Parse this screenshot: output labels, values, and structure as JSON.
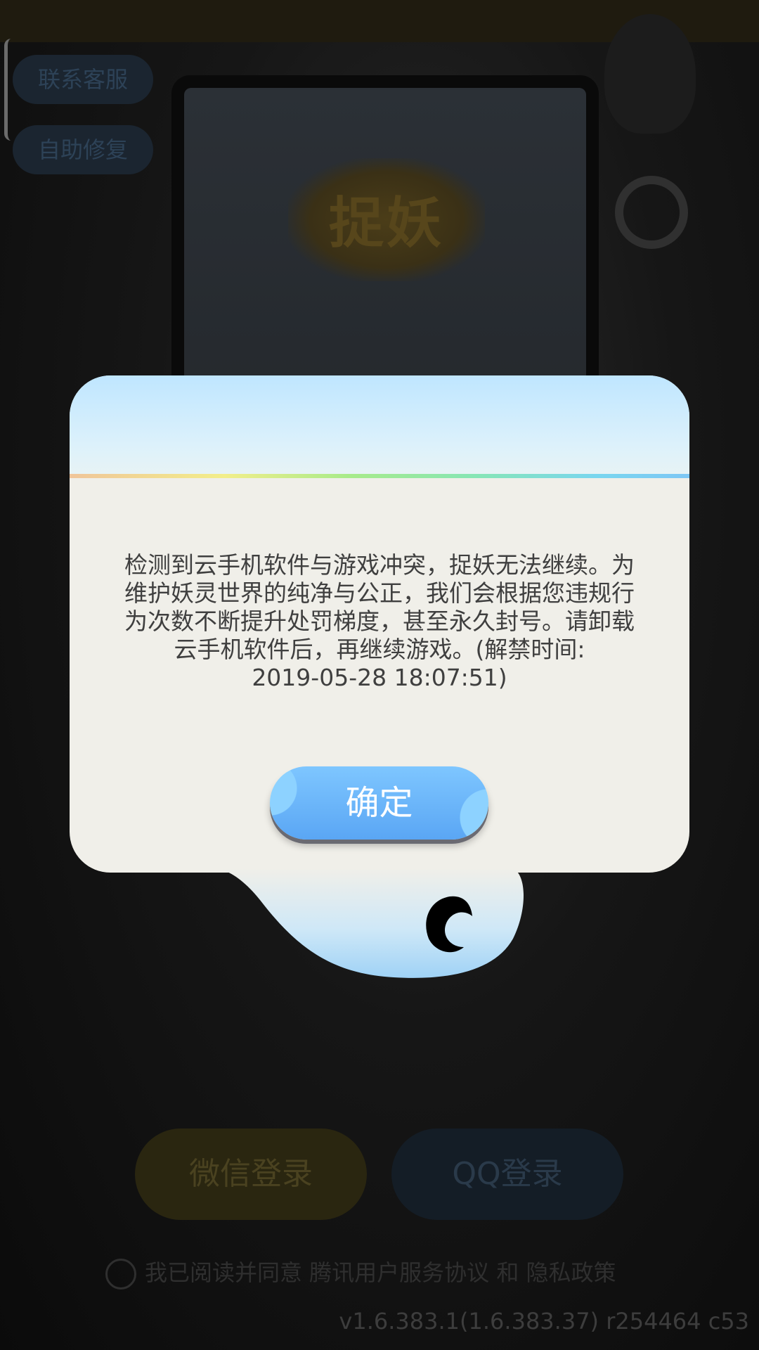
{
  "background": {
    "corner_buttons": [
      "联系客服",
      "自助修复"
    ],
    "logo_text": "捉妖",
    "login_wechat": "微信登录",
    "login_qq": "QQ登录",
    "agreement": "我已阅读并同意 腾讯用户服务协议 和 隐私政策",
    "version": "v1.6.383.1(1.6.383.37) r254464 c53"
  },
  "dialog": {
    "message": "检测到云手机软件与游戏冲突，捉妖无法继续。为\n维护妖灵世界的纯净与公正，我们会根据您违规行\n为次数不断提升处罚梯度，甚至永久封号。请卸载\n云手机软件后，再继续游戏。(解禁时间:\n2019-05-28 18:07:51)",
    "confirm_label": "确定"
  },
  "colors": {
    "dialog_bg": "#f0efe9",
    "header_blue": "#bfe6ff",
    "button_blue": "#5aa6f4"
  }
}
